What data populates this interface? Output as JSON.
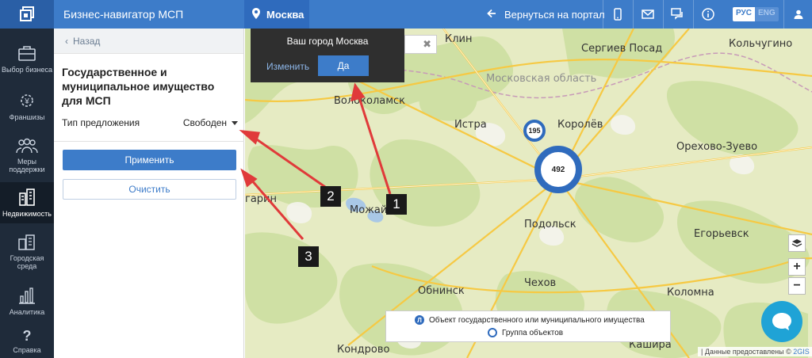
{
  "header": {
    "app_title": "Бизнес-навигатор МСП",
    "city": "Москва",
    "back_to_portal": "Вернуться на портал",
    "lang_ru": "РУС",
    "lang_en": "ENG",
    "icons": [
      "logo-icon",
      "location-pin-icon",
      "arrow-left-icon",
      "mobile-icon",
      "mail-icon",
      "chat-icon",
      "info-icon",
      "user-icon"
    ]
  },
  "sidebar": {
    "items": [
      {
        "label": "Выбор бизнеса",
        "icon": "briefcase-icon"
      },
      {
        "label": "Франшизы",
        "icon": "gear-icon"
      },
      {
        "label": "Меры поддержки",
        "icon": "people-icon"
      },
      {
        "label": "Недвижимость",
        "icon": "buildings-icon",
        "active": true
      },
      {
        "label": "Городская среда",
        "icon": "city-icon"
      },
      {
        "label": "Аналитика",
        "icon": "bar-chart-icon"
      },
      {
        "label": "Справка",
        "icon": "question-icon"
      }
    ]
  },
  "panel": {
    "back_label": "Назад",
    "title": "Государственное и муниципальное имущество для МСП",
    "type_label": "Тип предложения",
    "type_value": "Свободен",
    "apply_label": "Применить",
    "clear_label": "Очистить"
  },
  "popup": {
    "title": "Ваш город Москва",
    "change_label": "Изменить",
    "yes_label": "Да",
    "close_glyph": "✖"
  },
  "map": {
    "labels": {
      "klin": "Клин",
      "sergiev": "Сергиев Посад",
      "kolchugino": "Кольчугино",
      "region": "Московская область",
      "volokolamsk": "Волоколамск",
      "istra": "Истра",
      "korolev": "Королёв",
      "orekhovo": "Орехово-Зуево",
      "gagarin": "гарин",
      "mozhaisk": "Можайск",
      "podolsk": "Подольск",
      "egorievsk": "Егорьевск",
      "obninsk": "Обнинск",
      "chekhov": "Чехов",
      "kolomna": "Коломна",
      "kondrovo": "Кондрово",
      "kashira": "Кашира"
    },
    "clusters": {
      "big": "492",
      "small": "195"
    },
    "zoom_in": "+",
    "zoom_out": "−",
    "legend": {
      "object_label": "Объект государственного или муниципального имущества",
      "object_marker": "Л",
      "group_label": "Группа объектов"
    },
    "attribution_prefix": "| Данные предоставлены ©",
    "attribution_brand": "2GIS"
  },
  "annotations": {
    "badge1": "1",
    "badge2": "2",
    "badge3": "3"
  },
  "colors": {
    "primary": "#3d7cc9",
    "nav_bg": "#1f2b3a",
    "arrow": "#e03a3a"
  }
}
